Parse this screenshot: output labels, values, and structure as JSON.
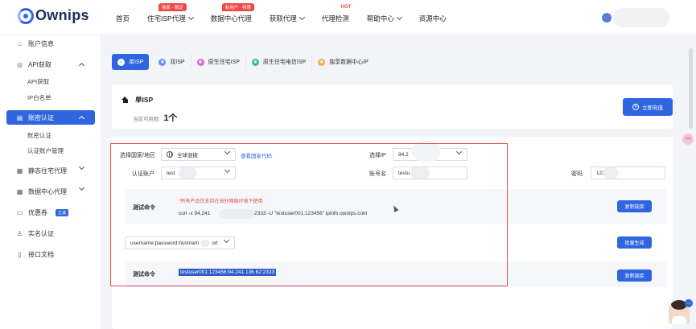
{
  "brand": {
    "logo_text": "Ownips",
    "accent_color": "#2f66e0",
    "warning_color": "#e04a4a"
  },
  "header": {
    "nav": [
      {
        "label": "首页",
        "has_dropdown": false
      },
      {
        "label": "住宅ISP代理",
        "has_dropdown": true,
        "tag": "独家 · 稳定"
      },
      {
        "label": "数据中心代理",
        "has_dropdown": false,
        "tag": "新用户 · 特惠"
      },
      {
        "label": "获取代理",
        "has_dropdown": true
      },
      {
        "label": "代理检测",
        "has_dropdown": false,
        "hot": "HOT"
      },
      {
        "label": "帮助中心",
        "has_dropdown": true
      },
      {
        "label": "资源中心",
        "has_dropdown": false
      }
    ]
  },
  "sidebar": {
    "items": [
      {
        "label": "账户信息",
        "icon": "home-icon"
      },
      {
        "label": "API获取",
        "icon": "globe-icon",
        "expanded": true,
        "children": [
          "API获取",
          "IP白名单"
        ]
      },
      {
        "label": "账密认证",
        "icon": "list-icon",
        "expanded": true,
        "active": true,
        "children": [
          "账密认证",
          "认证账户管理"
        ]
      },
      {
        "label": "静态住宅代理",
        "icon": "grid-icon"
      },
      {
        "label": "数据中心代理",
        "icon": "grid-icon"
      },
      {
        "label": "优惠券",
        "icon": "coupon-icon",
        "badge": "立减"
      },
      {
        "label": "实名认证",
        "icon": "user-icon"
      },
      {
        "label": "接口文档",
        "icon": "doc-icon"
      }
    ]
  },
  "tabs": [
    {
      "label": "单ISP",
      "active": true,
      "color": "#2f66e0"
    },
    {
      "label": "双ISP",
      "color": "#6a8ff0"
    },
    {
      "label": "原生住宅ISP",
      "color": "#d86ad6"
    },
    {
      "label": "原生住宅电信ISP",
      "color": "#38b89a"
    },
    {
      "label": "独享数据中心IP",
      "color": "#f0b43a"
    }
  ],
  "isp": {
    "title": "单ISP",
    "available_label": "当前可用数:",
    "available_count": "1个",
    "buy_button": "立即充值"
  },
  "form": {
    "region_label": "选择国家/地区",
    "region_value": "全球混拨",
    "region_link": "查看国家代码",
    "ip_label": "选择IP",
    "ip_value": "94.2",
    "account_label": "认证账户",
    "account_value": "test",
    "username_label": "账号名",
    "username_value": "testu",
    "password_label": "密码",
    "password_value": "123"
  },
  "test1": {
    "label": "测试命令",
    "warning": "*所有产品仅支持在海外网络环境下使用",
    "cmd_part1": "curl -x 94.241",
    "cmd_part2": "2333 -U \"testuser001:123456\" ipinfo.ownips.com",
    "copy_button": "复制链接"
  },
  "format": {
    "value": "username:password:hostnam",
    "value_tail": "ort"
  },
  "batch_button": "批量生成",
  "test2": {
    "label": "测试命令",
    "highlight": "testuser001:123456:94.241.136.62:2333",
    "copy_button": "复制链接"
  },
  "floating": {
    "pink_label": "<<",
    "cs_badge": "…"
  }
}
